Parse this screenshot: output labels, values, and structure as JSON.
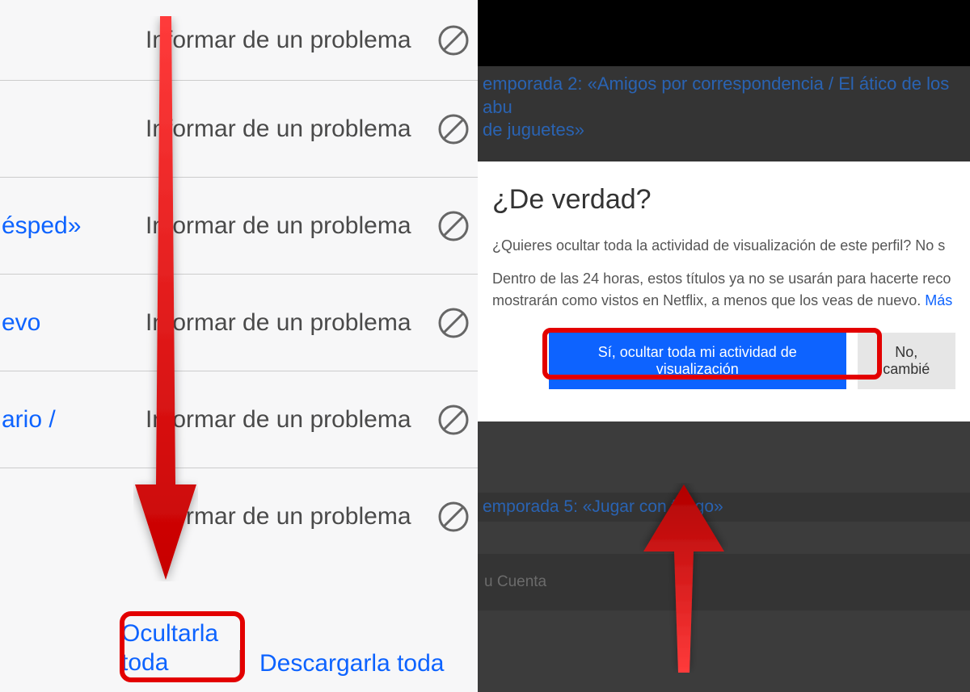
{
  "left": {
    "sideLinks": [
      "",
      "",
      "ésped»",
      "evo",
      "ario /",
      ""
    ],
    "reportLabel": "Informar de un problema",
    "hideAll": "Ocultarla toda",
    "downloadAll": "Descargarla toda"
  },
  "right": {
    "episodeTop": "emporada 2: «Amigos por correspondencia / El ático de los abu",
    "episodeTop2": "de juguetes»",
    "modal": {
      "title": "¿De verdad?",
      "p1": "¿Quieres ocultar toda la actividad de visualización de este perfil? No s",
      "p2a": "Dentro de las 24 horas, estos títulos ya no se usarán para hacerte reco",
      "p2b": "mostrarán como vistos en Netflix, a menos que los veas de nuevo. ",
      "moreLink": "Más",
      "confirm": "Sí, ocultar toda mi actividad de visualización",
      "cancel": "No, cambié "
    },
    "episodeBottom": "emporada 5: «Jugar con fuego»",
    "account": "u Cuenta"
  }
}
